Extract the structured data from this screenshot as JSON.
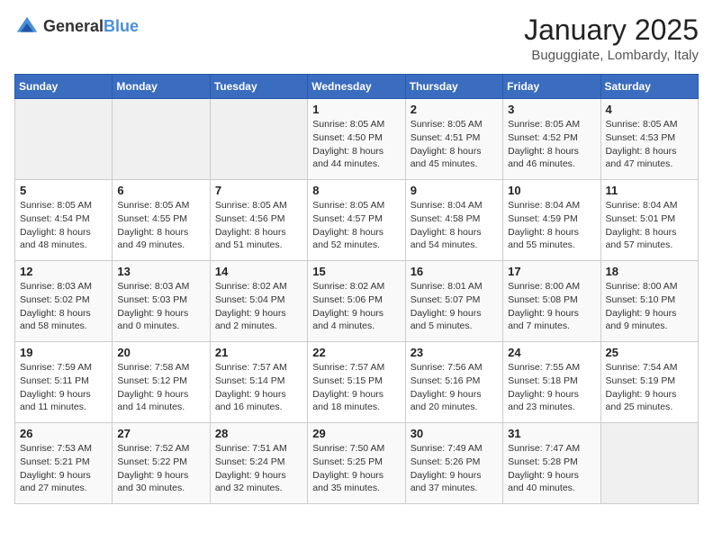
{
  "header": {
    "logo_general": "General",
    "logo_blue": "Blue",
    "title": "January 2025",
    "location": "Buguggiate, Lombardy, Italy"
  },
  "days_of_week": [
    "Sunday",
    "Monday",
    "Tuesday",
    "Wednesday",
    "Thursday",
    "Friday",
    "Saturday"
  ],
  "weeks": [
    [
      {
        "num": "",
        "info": ""
      },
      {
        "num": "",
        "info": ""
      },
      {
        "num": "",
        "info": ""
      },
      {
        "num": "1",
        "info": "Sunrise: 8:05 AM\nSunset: 4:50 PM\nDaylight: 8 hours\nand 44 minutes."
      },
      {
        "num": "2",
        "info": "Sunrise: 8:05 AM\nSunset: 4:51 PM\nDaylight: 8 hours\nand 45 minutes."
      },
      {
        "num": "3",
        "info": "Sunrise: 8:05 AM\nSunset: 4:52 PM\nDaylight: 8 hours\nand 46 minutes."
      },
      {
        "num": "4",
        "info": "Sunrise: 8:05 AM\nSunset: 4:53 PM\nDaylight: 8 hours\nand 47 minutes."
      }
    ],
    [
      {
        "num": "5",
        "info": "Sunrise: 8:05 AM\nSunset: 4:54 PM\nDaylight: 8 hours\nand 48 minutes."
      },
      {
        "num": "6",
        "info": "Sunrise: 8:05 AM\nSunset: 4:55 PM\nDaylight: 8 hours\nand 49 minutes."
      },
      {
        "num": "7",
        "info": "Sunrise: 8:05 AM\nSunset: 4:56 PM\nDaylight: 8 hours\nand 51 minutes."
      },
      {
        "num": "8",
        "info": "Sunrise: 8:05 AM\nSunset: 4:57 PM\nDaylight: 8 hours\nand 52 minutes."
      },
      {
        "num": "9",
        "info": "Sunrise: 8:04 AM\nSunset: 4:58 PM\nDaylight: 8 hours\nand 54 minutes."
      },
      {
        "num": "10",
        "info": "Sunrise: 8:04 AM\nSunset: 4:59 PM\nDaylight: 8 hours\nand 55 minutes."
      },
      {
        "num": "11",
        "info": "Sunrise: 8:04 AM\nSunset: 5:01 PM\nDaylight: 8 hours\nand 57 minutes."
      }
    ],
    [
      {
        "num": "12",
        "info": "Sunrise: 8:03 AM\nSunset: 5:02 PM\nDaylight: 8 hours\nand 58 minutes."
      },
      {
        "num": "13",
        "info": "Sunrise: 8:03 AM\nSunset: 5:03 PM\nDaylight: 9 hours\nand 0 minutes."
      },
      {
        "num": "14",
        "info": "Sunrise: 8:02 AM\nSunset: 5:04 PM\nDaylight: 9 hours\nand 2 minutes."
      },
      {
        "num": "15",
        "info": "Sunrise: 8:02 AM\nSunset: 5:06 PM\nDaylight: 9 hours\nand 4 minutes."
      },
      {
        "num": "16",
        "info": "Sunrise: 8:01 AM\nSunset: 5:07 PM\nDaylight: 9 hours\nand 5 minutes."
      },
      {
        "num": "17",
        "info": "Sunrise: 8:00 AM\nSunset: 5:08 PM\nDaylight: 9 hours\nand 7 minutes."
      },
      {
        "num": "18",
        "info": "Sunrise: 8:00 AM\nSunset: 5:10 PM\nDaylight: 9 hours\nand 9 minutes."
      }
    ],
    [
      {
        "num": "19",
        "info": "Sunrise: 7:59 AM\nSunset: 5:11 PM\nDaylight: 9 hours\nand 11 minutes."
      },
      {
        "num": "20",
        "info": "Sunrise: 7:58 AM\nSunset: 5:12 PM\nDaylight: 9 hours\nand 14 minutes."
      },
      {
        "num": "21",
        "info": "Sunrise: 7:57 AM\nSunset: 5:14 PM\nDaylight: 9 hours\nand 16 minutes."
      },
      {
        "num": "22",
        "info": "Sunrise: 7:57 AM\nSunset: 5:15 PM\nDaylight: 9 hours\nand 18 minutes."
      },
      {
        "num": "23",
        "info": "Sunrise: 7:56 AM\nSunset: 5:16 PM\nDaylight: 9 hours\nand 20 minutes."
      },
      {
        "num": "24",
        "info": "Sunrise: 7:55 AM\nSunset: 5:18 PM\nDaylight: 9 hours\nand 23 minutes."
      },
      {
        "num": "25",
        "info": "Sunrise: 7:54 AM\nSunset: 5:19 PM\nDaylight: 9 hours\nand 25 minutes."
      }
    ],
    [
      {
        "num": "26",
        "info": "Sunrise: 7:53 AM\nSunset: 5:21 PM\nDaylight: 9 hours\nand 27 minutes."
      },
      {
        "num": "27",
        "info": "Sunrise: 7:52 AM\nSunset: 5:22 PM\nDaylight: 9 hours\nand 30 minutes."
      },
      {
        "num": "28",
        "info": "Sunrise: 7:51 AM\nSunset: 5:24 PM\nDaylight: 9 hours\nand 32 minutes."
      },
      {
        "num": "29",
        "info": "Sunrise: 7:50 AM\nSunset: 5:25 PM\nDaylight: 9 hours\nand 35 minutes."
      },
      {
        "num": "30",
        "info": "Sunrise: 7:49 AM\nSunset: 5:26 PM\nDaylight: 9 hours\nand 37 minutes."
      },
      {
        "num": "31",
        "info": "Sunrise: 7:47 AM\nSunset: 5:28 PM\nDaylight: 9 hours\nand 40 minutes."
      },
      {
        "num": "",
        "info": ""
      }
    ]
  ]
}
